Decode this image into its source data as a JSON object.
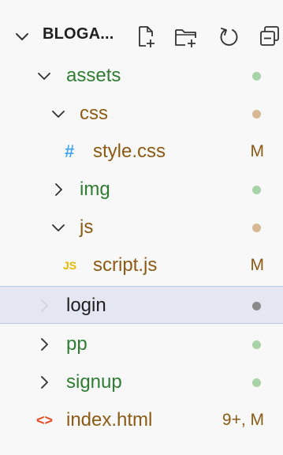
{
  "header": {
    "title": "BLOGA...",
    "actions": {
      "new_file_icon": "new-file-icon",
      "new_folder_icon": "new-folder-icon",
      "refresh_icon": "refresh-icon",
      "collapse_icon": "collapse-all-icon"
    }
  },
  "colors": {
    "folder_label": "#2e7d32",
    "file_label": "#8b5a14",
    "dot_green": "#a8d3a6",
    "dot_tan": "#d8b996",
    "dot_gray": "#8a8a8a",
    "selected_bg": "#e4e6f1",
    "selected_border": "#b9cde8"
  },
  "tree": [
    {
      "label": "assets",
      "kind": "folder",
      "expanded": true,
      "status": "dot",
      "dot": "green"
    },
    {
      "label": "css",
      "kind": "folder",
      "expanded": true,
      "status": "dot",
      "dot": "tan"
    },
    {
      "label": "style.css",
      "kind": "file",
      "icon": "#",
      "status": "badge",
      "badge": "M"
    },
    {
      "label": "img",
      "kind": "folder",
      "expanded": false,
      "status": "dot",
      "dot": "green"
    },
    {
      "label": "js",
      "kind": "folder",
      "expanded": true,
      "status": "dot",
      "dot": "tan"
    },
    {
      "label": "script.js",
      "kind": "file",
      "icon": "JS",
      "status": "badge",
      "badge": "M"
    },
    {
      "label": "login",
      "kind": "folder",
      "expanded": false,
      "status": "dot",
      "dot": "gray",
      "selected": true
    },
    {
      "label": "pp",
      "kind": "folder",
      "expanded": false,
      "status": "dot",
      "dot": "green"
    },
    {
      "label": "signup",
      "kind": "folder",
      "expanded": false,
      "status": "dot",
      "dot": "green"
    },
    {
      "label": "index.html",
      "kind": "file",
      "icon": "<>",
      "status": "badge",
      "badge": "9+, M"
    }
  ]
}
